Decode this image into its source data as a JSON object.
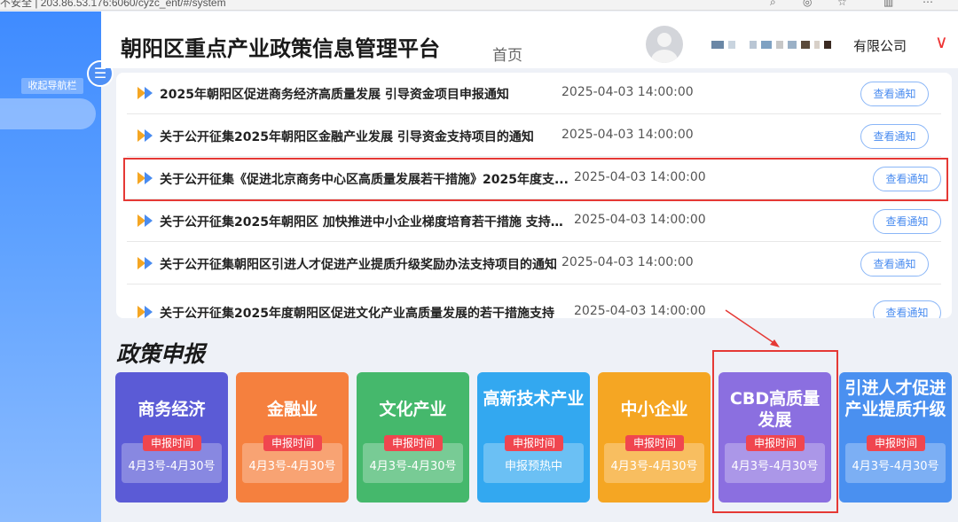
{
  "browser": {
    "url": "不安全 | 203.86.53.176:6060/cyzc_ent/#/system"
  },
  "sidebar": {
    "collapse_label": "收起导航栏",
    "collapse_icon": "menu-collapse-icon"
  },
  "header": {
    "title": "朝阳区重点产业政策信息管理平台",
    "breadcrumb": "首页",
    "company": "有限公司"
  },
  "notices": {
    "button_label": "查看通知",
    "rows": [
      {
        "title": "2025年朝阳区促进商务经济高质量发展 引导资金项目申报通知",
        "date": "2025-04-03 14:00:00"
      },
      {
        "title": "关于公开征集2025年朝阳区金融产业发展 引导资金支持项目的通知",
        "date": "2025-04-03 14:00:00"
      },
      {
        "title": "关于公开征集《促进北京商务中心区高质量发展若干措施》2025年度支...",
        "date": "2025-04-03 14:00:00"
      },
      {
        "title": "关于公开征集2025年朝阳区 加快推进中小企业梯度培育若干措施 支持项...",
        "date": "2025-04-03 14:00:00"
      },
      {
        "title": "关于公开征集朝阳区引进人才促进产业提质升级奖励办法支持项目的通知",
        "date": "2025-04-03 14:00:00"
      },
      {
        "title": "关于公开征集2025年度朝阳区促进文化产业高质量发展的若干措施支持",
        "date": "2025-04-03 14:00:00"
      }
    ]
  },
  "policy": {
    "section_title": "政策申报",
    "badge_label": "申报时间",
    "cards": [
      {
        "title": "商务经济",
        "time": "4月3号-4月30号",
        "color": "#5b5bd6"
      },
      {
        "title": "金融业",
        "time": "4月3号-4月30号",
        "color": "#f5803e"
      },
      {
        "title": "文化产业",
        "time": "4月3号-4月30号",
        "color": "#45b86c"
      },
      {
        "title": "高新技术产业",
        "time": "申报预热中",
        "color": "#33a8f0"
      },
      {
        "title": "中小企业",
        "time": "4月3号-4月30号",
        "color": "#f5a623"
      },
      {
        "title": "CBD高质量发展",
        "time": "4月3号-4月30号",
        "color": "#8b6fe0"
      },
      {
        "title": "引进人才促进产业提质升级",
        "time": "4月3号-4月30号",
        "color": "#4a90f0"
      }
    ]
  },
  "colors": {
    "accent": "#4a8cf0",
    "highlight": "#e53935",
    "sidebar": "#3f8bff"
  }
}
